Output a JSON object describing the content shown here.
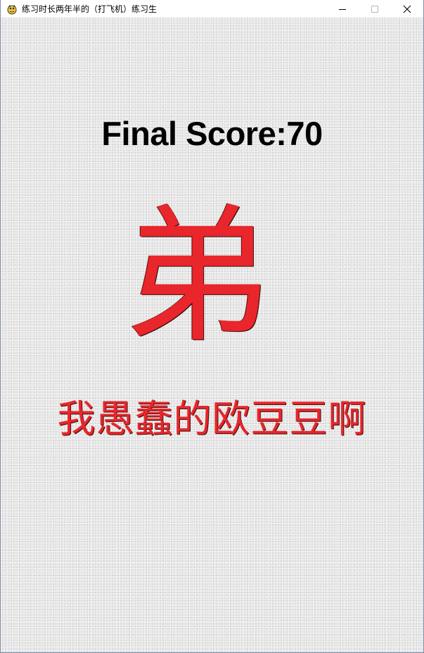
{
  "window": {
    "title": "练习时长两年半的（打飞机）练习生",
    "icon": "pygame-snake-icon",
    "controls": {
      "minimize": "minimize-icon",
      "maximize": "maximize-icon",
      "close": "close-icon"
    }
  },
  "game_over": {
    "score_label": "Final Score:70",
    "big_character": "弟",
    "phrase": "我愚蠢的欧豆豆啊"
  },
  "colors": {
    "text_dark": "#000000",
    "accent_red": "#e8262b",
    "background": "#e6e6e6"
  }
}
